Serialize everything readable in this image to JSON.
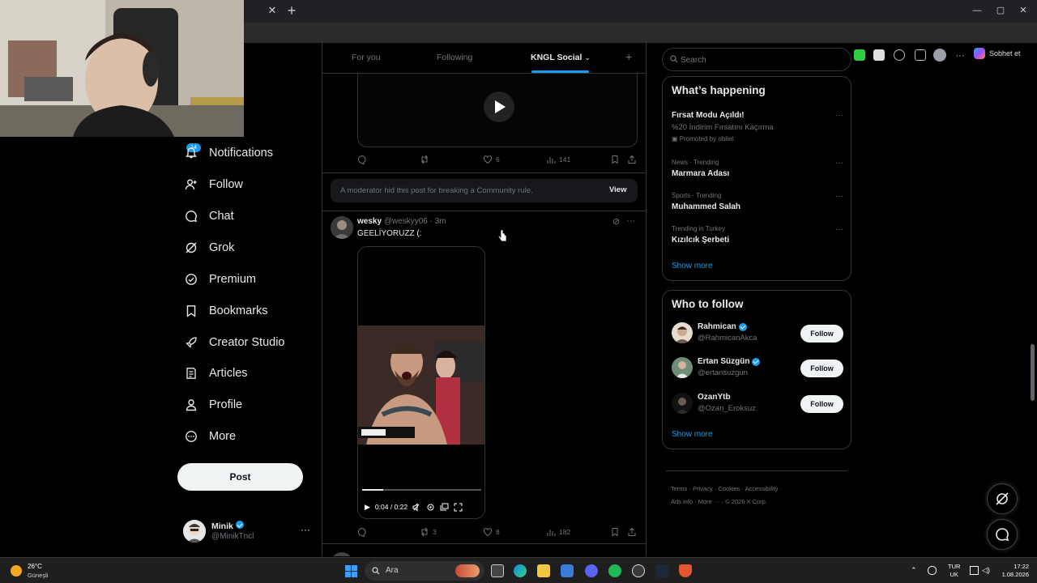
{
  "browser": {
    "profile_button": "Sobhet et"
  },
  "nav": {
    "notifications_badge": "14",
    "items": [
      {
        "label": "Notifications",
        "icon": "bell-icon"
      },
      {
        "label": "Follow",
        "icon": "person-add-icon"
      },
      {
        "label": "Chat",
        "icon": "chat-bubble-icon"
      },
      {
        "label": "Grok",
        "icon": "grok-icon"
      },
      {
        "label": "Premium",
        "icon": "premium-icon"
      },
      {
        "label": "Bookmarks",
        "icon": "bookmark-icon"
      },
      {
        "label": "Creator Studio",
        "icon": "rocket-icon"
      },
      {
        "label": "Articles",
        "icon": "article-icon"
      },
      {
        "label": "Profile",
        "icon": "profile-icon"
      },
      {
        "label": "More",
        "icon": "more-circle-icon"
      }
    ],
    "post_button": "Post",
    "account": {
      "name": "Minik",
      "handle": "@MinikTncl"
    }
  },
  "timeline": {
    "tabs": [
      {
        "label": "For you"
      },
      {
        "label": "Following"
      },
      {
        "label": "KNGL Social"
      }
    ],
    "active_tab": "KNGL Social",
    "prev_post": {
      "likes": "6",
      "views": "141"
    },
    "moderation_notice": {
      "text": "A moderator hid this post for breaking a Community rule.",
      "action": "View"
    },
    "post": {
      "name": "wesky",
      "handle": "@weskyy06",
      "time": "3m",
      "text": "GEELİYORUZZ (:",
      "video": {
        "time": "0:04 / 0:22",
        "progress": 0.18
      },
      "retweets": "3",
      "likes": "8",
      "views": "182"
    }
  },
  "sidebar": {
    "search_placeholder": "Search",
    "happening": {
      "title": "What’s happening",
      "trends": [
        {
          "meta": "",
          "title": "Fırsat Modu Açıldı!",
          "desc": "%20 İndirim Fırsatını Kaçırma",
          "promo": "Promoted by obilet"
        },
        {
          "meta": "News · Trending",
          "title": "Marmara Adası"
        },
        {
          "meta": "Sports · Trending",
          "title": "Muhammed Salah"
        },
        {
          "meta": "Trending in Turkey",
          "title": "Kızılcık Şerbeti"
        }
      ],
      "show_more": "Show more"
    },
    "who_to_follow": {
      "title": "Who to follow",
      "users": [
        {
          "name": "Rahmican",
          "handle": "@RahmicanAkca",
          "button": "Follow"
        },
        {
          "name": "Ertan Süzgün",
          "handle": "@ertansuzgun",
          "button": "Follow"
        },
        {
          "name": "OzanYtb",
          "handle": "@Ozan_Eroksuz",
          "button": "Follow"
        }
      ],
      "show_more": "Show more"
    },
    "footer": {
      "line1": "Terms  ·  Privacy  ·  Cookies  ·  Accessibility  ·",
      "line2": "Ads info  ·  More ···  ·  © 2026 X Corp."
    }
  },
  "taskbar": {
    "weather_temp": "26°C",
    "weather_desc": "Güneşli",
    "search_label": "Ara",
    "lang_top": "TUR",
    "lang_bottom": "UK",
    "time": "17:22",
    "date": "1.08.2026"
  }
}
